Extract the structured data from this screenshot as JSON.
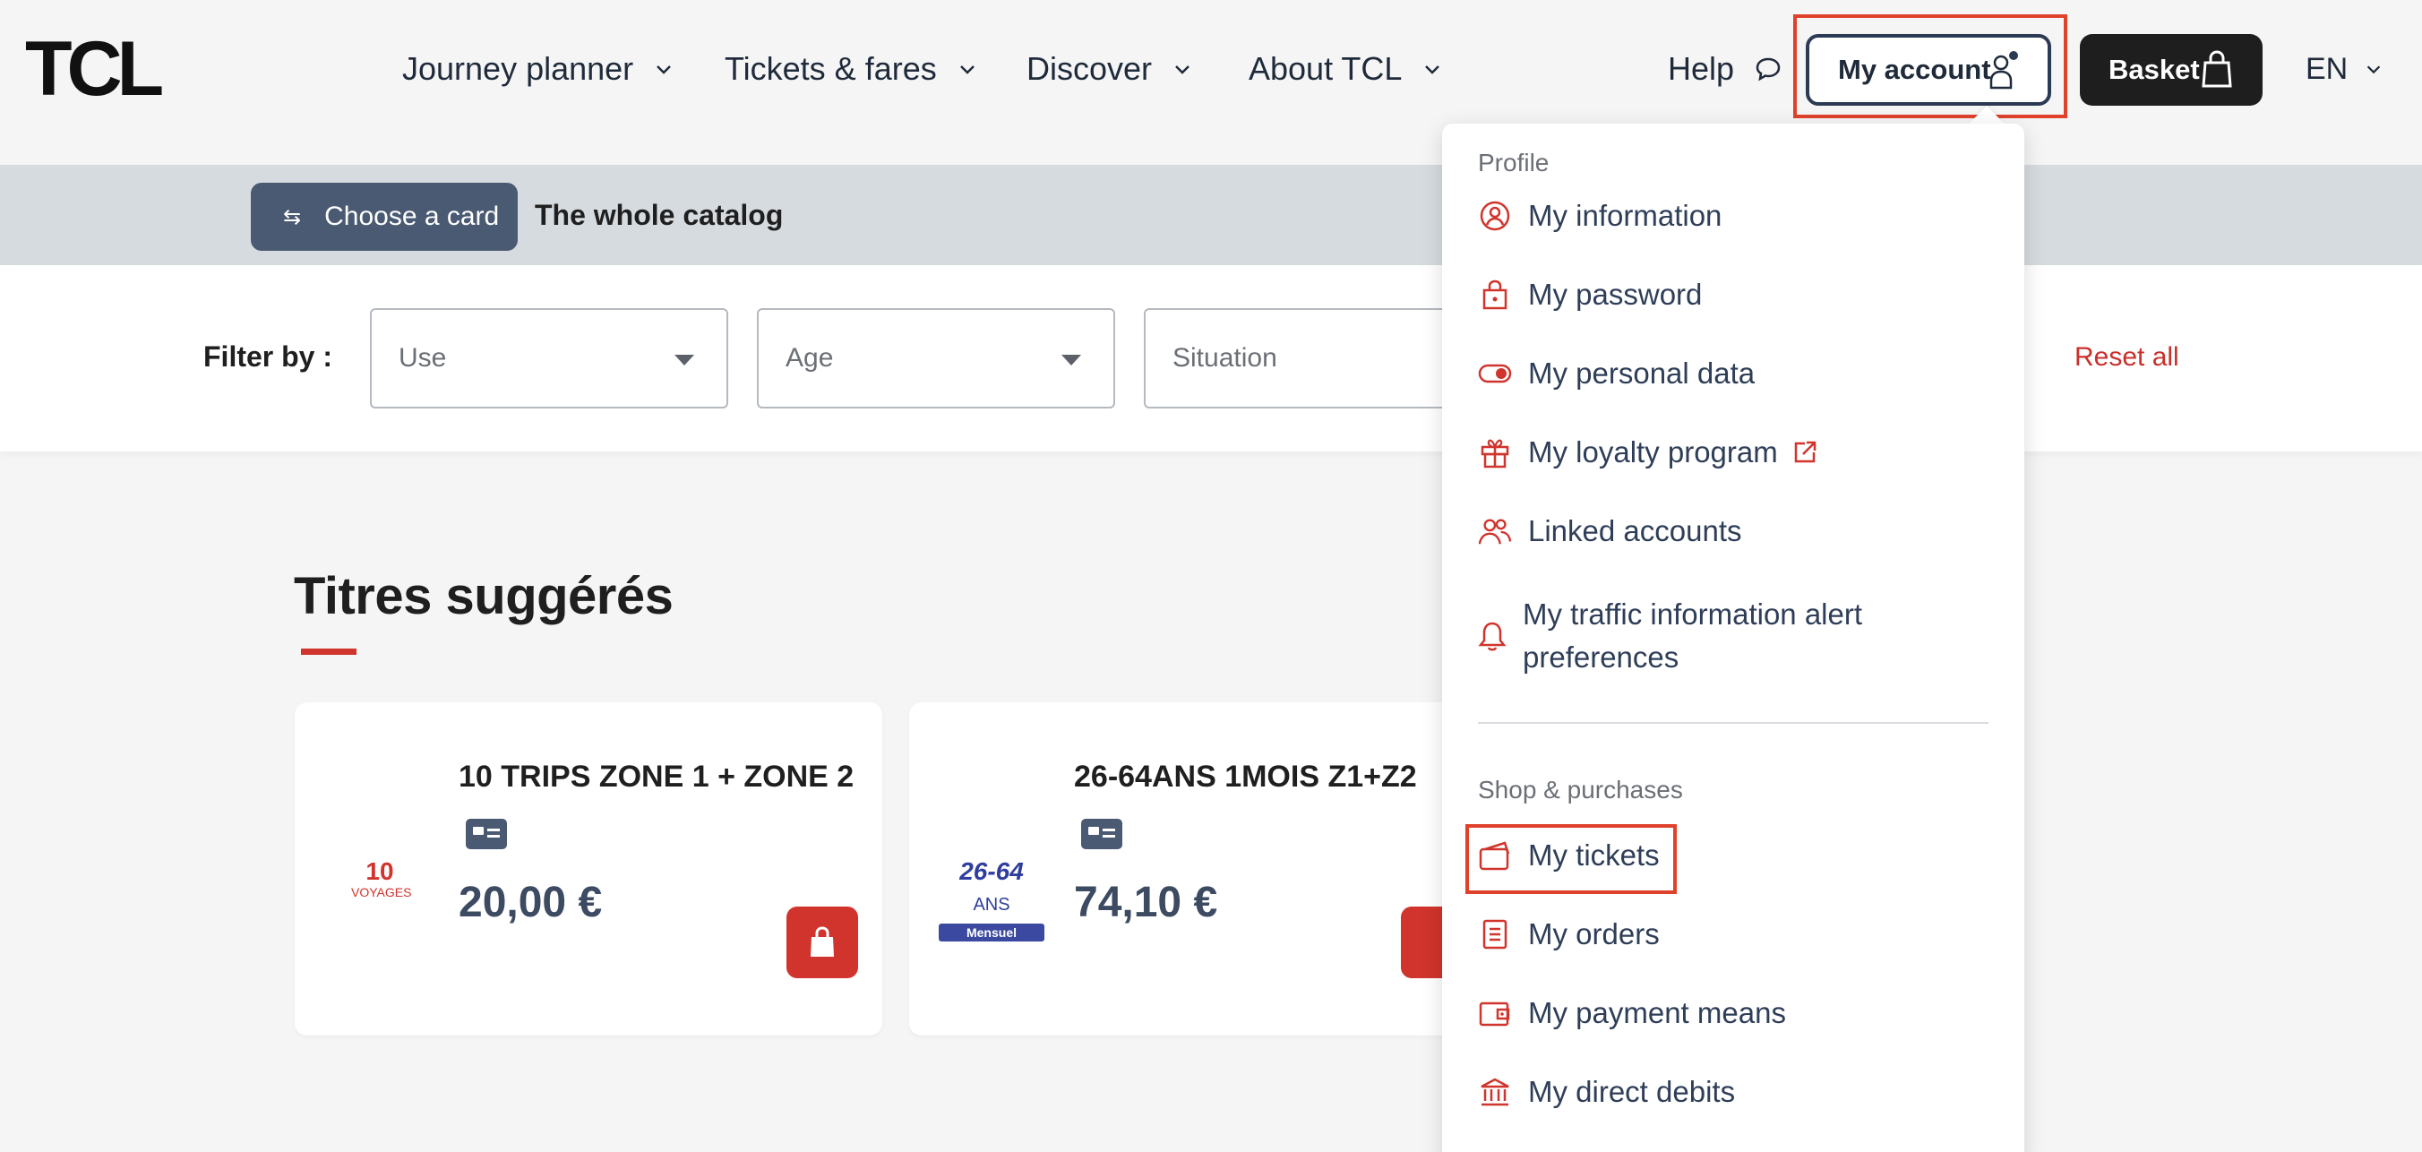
{
  "header": {
    "logo_text": "TCL",
    "nav": [
      {
        "label": "Journey planner"
      },
      {
        "label": "Tickets & fares"
      },
      {
        "label": "Discover"
      },
      {
        "label": "About TCL"
      }
    ],
    "help_label": "Help",
    "account_label": "My account",
    "basket_label": "Basket",
    "language": "EN"
  },
  "catalog": {
    "choose_card_label": "Choose a card",
    "whole_catalog_label": "The whole catalog"
  },
  "filters": {
    "label": "Filter by :",
    "use_placeholder": "Use",
    "age_placeholder": "Age",
    "situation_placeholder": "Situation",
    "reset_label": "Reset all"
  },
  "suggested": {
    "title": "Titres suggérés",
    "cards": [
      {
        "title": "10 TRIPS ZONE 1 + ZONE 2",
        "price": "20,00 €",
        "logo_big": "10",
        "logo_small": "VOYAGES"
      },
      {
        "title": "26-64ANS 1MOIS Z1+Z2",
        "price": "74,10 €",
        "logo_big": "26-64",
        "logo_suffix": "ANS",
        "logo_pill": "Mensuel"
      }
    ]
  },
  "account_menu": {
    "profile_heading": "Profile",
    "profile_items": [
      {
        "label": "My information",
        "icon": "user-circle-icon"
      },
      {
        "label": "My password",
        "icon": "lock-icon"
      },
      {
        "label": "My personal data",
        "icon": "toggle-icon"
      },
      {
        "label": "My loyalty program",
        "icon": "gift-icon"
      },
      {
        "label": "Linked accounts",
        "icon": "users-icon"
      },
      {
        "label": "My traffic information alert preferences",
        "icon": "bell-icon"
      }
    ],
    "shop_heading": "Shop & purchases",
    "shop_items": [
      {
        "label": "My tickets",
        "icon": "ticket-icon"
      },
      {
        "label": "My orders",
        "icon": "document-icon"
      },
      {
        "label": "My payment means",
        "icon": "wallet-icon"
      },
      {
        "label": "My direct debits",
        "icon": "bank-icon"
      }
    ]
  },
  "colors": {
    "accent_red": "#d0342c",
    "navy": "#2b3a55",
    "highlight": "#e0412b"
  }
}
